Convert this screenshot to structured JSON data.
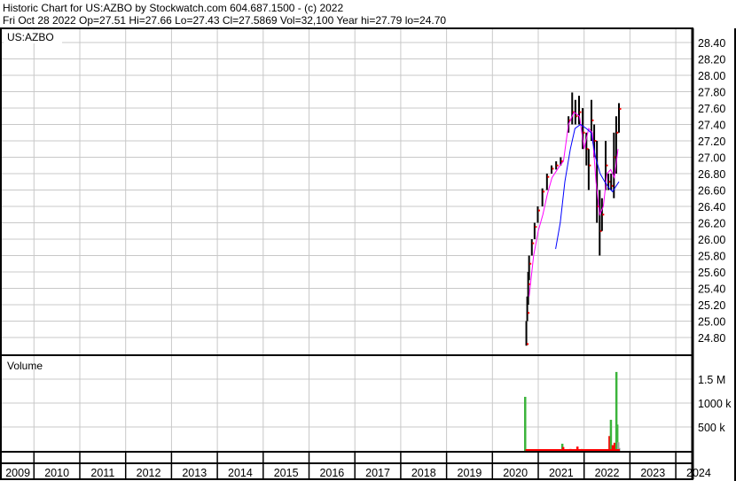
{
  "header": {
    "line1": "Historic Chart for US:AZBO by Stockwatch.com 604.687.1500 - (c) 2022",
    "line2": "Fri Oct 28 2022   Op=27.51  Hi=27.66  Lo=27.43  Cl=27.5869  Vol=32,100   Year hi=27.79  lo=24.70"
  },
  "chart_data": {
    "type": "line",
    "symbol_label": "US:AZBO",
    "volume_label": "Volume",
    "price_ticks": [
      "24.80",
      "25.00",
      "25.20",
      "25.40",
      "25.60",
      "25.80",
      "26.00",
      "26.20",
      "26.40",
      "26.60",
      "26.80",
      "27.00",
      "27.20",
      "27.40",
      "27.60",
      "27.80",
      "28.00",
      "28.20",
      "28.40"
    ],
    "price_ylim": [
      24.8,
      28.4
    ],
    "volume_ticks": [
      {
        "value": 500000,
        "label": "500 k"
      },
      {
        "value": 1000000,
        "label": "1000 k"
      },
      {
        "value": 1500000,
        "label": "1.5 M"
      }
    ],
    "years": [
      "2009",
      "2010",
      "2011",
      "2012",
      "2013",
      "2014",
      "2015",
      "2016",
      "2017",
      "2018",
      "2019",
      "2020",
      "2021",
      "2022",
      "2023",
      "2024"
    ],
    "colors": {
      "bar": "#000000",
      "close": "#ff0000",
      "ma_short": "#ff00ff",
      "ma_long": "#0000ff",
      "vol_up": "#3cb43c",
      "vol_down": "#ff0000",
      "vol_flat": "#a0a0a0",
      "grid": "#c8c8c8"
    },
    "price_bars": [
      [
        2020.74,
        24.7,
        25.0,
        24.72
      ],
      [
        2020.76,
        25.0,
        25.3,
        25.1
      ],
      [
        2020.78,
        25.2,
        25.6,
        25.45
      ],
      [
        2020.8,
        25.5,
        25.8,
        25.7
      ],
      [
        2020.86,
        25.8,
        26.0,
        25.95
      ],
      [
        2020.92,
        26.0,
        26.2,
        26.15
      ],
      [
        2020.99,
        26.2,
        26.4,
        26.35
      ],
      [
        2021.09,
        26.4,
        26.62,
        26.58
      ],
      [
        2021.19,
        26.6,
        26.8,
        26.76
      ],
      [
        2021.29,
        26.8,
        26.9,
        26.86
      ],
      [
        2021.39,
        26.85,
        26.95,
        26.9
      ],
      [
        2021.49,
        26.9,
        27.0,
        26.95
      ],
      [
        2021.66,
        27.3,
        27.5,
        27.45
      ],
      [
        2021.74,
        27.4,
        27.79,
        27.55
      ],
      [
        2021.81,
        27.4,
        27.7,
        27.5
      ],
      [
        2021.89,
        27.4,
        27.75,
        27.55
      ],
      [
        2021.97,
        27.1,
        27.6,
        27.3
      ],
      [
        2022.05,
        26.9,
        27.3,
        27.1
      ],
      [
        2022.1,
        26.6,
        27.1,
        26.9
      ],
      [
        2022.16,
        27.2,
        27.7,
        27.45
      ],
      [
        2022.22,
        27.0,
        27.4,
        27.2
      ],
      [
        2022.28,
        26.2,
        27.2,
        26.4
      ],
      [
        2022.34,
        25.8,
        26.6,
        26.1
      ],
      [
        2022.39,
        26.1,
        26.5,
        26.3
      ],
      [
        2022.47,
        26.6,
        27.2,
        26.9
      ],
      [
        2022.53,
        26.6,
        26.8,
        26.7
      ],
      [
        2022.59,
        26.6,
        26.8,
        26.65
      ],
      [
        2022.65,
        26.5,
        27.3,
        27.0
      ],
      [
        2022.7,
        26.8,
        27.5,
        27.3
      ],
      [
        2022.76,
        27.3,
        27.66,
        27.59
      ]
    ],
    "ma_short": [
      [
        2020.8,
        25.3
      ],
      [
        2020.9,
        25.8
      ],
      [
        2021.0,
        26.1
      ],
      [
        2021.1,
        26.3
      ],
      [
        2021.2,
        26.55
      ],
      [
        2021.3,
        26.75
      ],
      [
        2021.45,
        26.88
      ],
      [
        2021.55,
        26.95
      ],
      [
        2021.66,
        27.4
      ],
      [
        2021.78,
        27.55
      ],
      [
        2021.9,
        27.5
      ],
      [
        2022.0,
        27.1
      ],
      [
        2022.1,
        27.35
      ],
      [
        2022.18,
        27.3
      ],
      [
        2022.26,
        26.7
      ],
      [
        2022.34,
        26.3
      ],
      [
        2022.42,
        26.4
      ],
      [
        2022.5,
        26.8
      ],
      [
        2022.58,
        26.85
      ],
      [
        2022.66,
        26.75
      ],
      [
        2022.74,
        27.1
      ]
    ],
    "ma_long": [
      [
        2021.38,
        25.88
      ],
      [
        2021.48,
        26.2
      ],
      [
        2021.58,
        26.7
      ],
      [
        2021.7,
        27.1
      ],
      [
        2021.8,
        27.35
      ],
      [
        2021.92,
        27.4
      ],
      [
        2022.05,
        27.35
      ],
      [
        2022.15,
        27.3
      ],
      [
        2022.25,
        27.0
      ],
      [
        2022.35,
        26.8
      ],
      [
        2022.45,
        26.7
      ],
      [
        2022.55,
        26.62
      ],
      [
        2022.62,
        26.58
      ],
      [
        2022.7,
        26.65
      ],
      [
        2022.76,
        26.7
      ]
    ],
    "volume": [
      [
        2020.71,
        1130000,
        "up"
      ],
      [
        2020.8,
        20000,
        "down"
      ],
      [
        2020.95,
        15000,
        "down"
      ],
      [
        2021.1,
        12000,
        "up"
      ],
      [
        2021.3,
        10000,
        "flat"
      ],
      [
        2021.52,
        150000,
        "up"
      ],
      [
        2021.54,
        80000,
        "down"
      ],
      [
        2021.7,
        40000,
        "down"
      ],
      [
        2021.85,
        90000,
        "down"
      ],
      [
        2021.95,
        40000,
        "up"
      ],
      [
        2022.1,
        30000,
        "down"
      ],
      [
        2022.2,
        25000,
        "up"
      ],
      [
        2022.55,
        310000,
        "down"
      ],
      [
        2022.58,
        650000,
        "up"
      ],
      [
        2022.62,
        120000,
        "down"
      ],
      [
        2022.66,
        170000,
        "down"
      ],
      [
        2022.7,
        1650000,
        "up"
      ],
      [
        2022.72,
        550000,
        "up"
      ],
      [
        2022.74,
        180000,
        "flat"
      ],
      [
        2022.76,
        60000,
        "flat"
      ]
    ]
  }
}
